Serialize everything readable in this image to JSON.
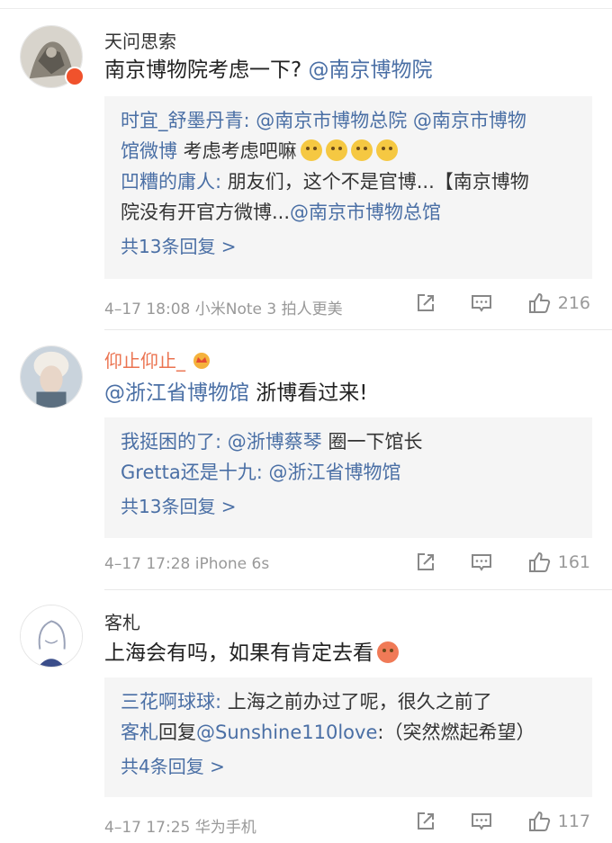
{
  "comments": [
    {
      "username": "天问思索",
      "text_main": "南京博物院考虑一下? ",
      "text_mention": "@南京博物院",
      "replies": [
        {
          "user": "时宜_舒墨丹青:",
          "mention": " @南京市博物总院  @南京市博物",
          "line2_mention": "馆微博",
          "line2_text": "  考虑考虑吧嘛"
        },
        {
          "user": "凹糟的庸人:",
          "text": " 朋友们，这个不是官博...【南京博物",
          "line2_text": "院没有开官方微博...",
          "line2_mention": "@南京市博物总馆"
        }
      ],
      "more": "共13条回复 >",
      "meta": "4–17 18:08  小米Note 3 拍人更美",
      "likes": "216"
    },
    {
      "username": "仰止仰止_",
      "text_mention": "@浙江省博物馆",
      "text_main": " 浙博看过来!",
      "replies": [
        {
          "user": "我挺困的了:",
          "mention": " @浙博蔡琴",
          "text": "  圈一下馆长"
        },
        {
          "user": "Gretta还是十九:",
          "mention": " @浙江省博物馆"
        }
      ],
      "more": "共13条回复 >",
      "meta": "4–17 17:28  iPhone 6s",
      "likes": "161"
    },
    {
      "username": "客札",
      "text_main": "上海会有吗，如果有肯定去看",
      "replies": [
        {
          "user": "三花啊球球:",
          "text": " 上海之前办过了呢，很久之前了"
        },
        {
          "user": "客札",
          "text_plain": "回复",
          "mention": "@Sunshine110love",
          "text": ":（突然燃起希望）"
        }
      ],
      "more": "共4条回复 >",
      "meta": "4–17 17:25  华为手机",
      "likes": "117"
    }
  ],
  "icons": {
    "share": "share-icon",
    "comment": "comment-icon",
    "like": "thumbs-up-icon",
    "crown": "vip-crown-icon"
  },
  "colors": {
    "link": "#4a6fa5",
    "vip_name": "#eb7350",
    "meta": "#999999",
    "reply_bg": "#f5f5f5"
  }
}
